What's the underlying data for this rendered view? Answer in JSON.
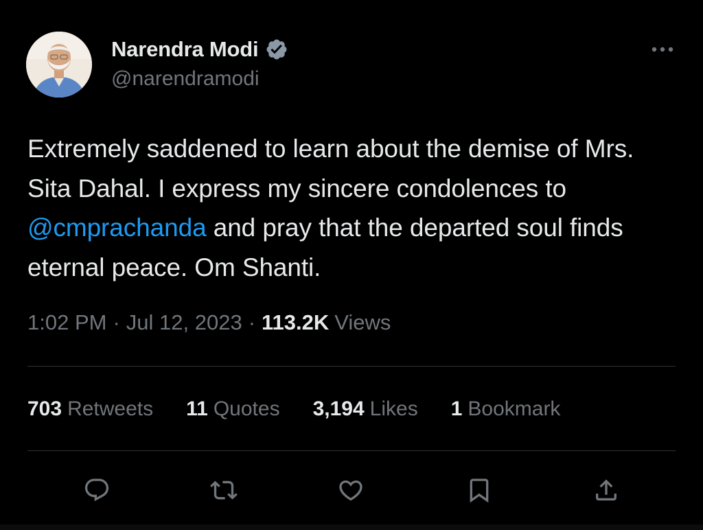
{
  "colors": {
    "background": "#000000",
    "primary_text": "#e7e9ea",
    "secondary_text": "#71767b",
    "link": "#1d9bf0",
    "divider": "#2f3336",
    "verified_badge": "#8b98a5"
  },
  "author": {
    "display_name": "Narendra Modi",
    "handle": "@narendramodi",
    "verified_icon": "verified-badge-icon",
    "avatar": "profile-photo"
  },
  "tweet": {
    "text_before_mention": "Extremely saddened to learn about the demise of Mrs. Sita Dahal. I express my sincere condolences to ",
    "mention": "@cmprachanda",
    "text_after_mention": " and pray that the departed soul finds eternal peace. Om Shanti."
  },
  "meta": {
    "time": "1:02 PM",
    "separator": "·",
    "date": "Jul 12, 2023",
    "views_count": "113.2K",
    "views_label": "Views"
  },
  "stats": [
    {
      "count": "703",
      "label": "Retweets"
    },
    {
      "count": "11",
      "label": "Quotes"
    },
    {
      "count": "3,194",
      "label": "Likes"
    },
    {
      "count": "1",
      "label": "Bookmark"
    }
  ],
  "actions": [
    {
      "icon": "reply-icon"
    },
    {
      "icon": "retweet-icon"
    },
    {
      "icon": "like-icon"
    },
    {
      "icon": "bookmark-icon"
    },
    {
      "icon": "share-icon"
    }
  ],
  "menu_icon": "more-options-icon"
}
